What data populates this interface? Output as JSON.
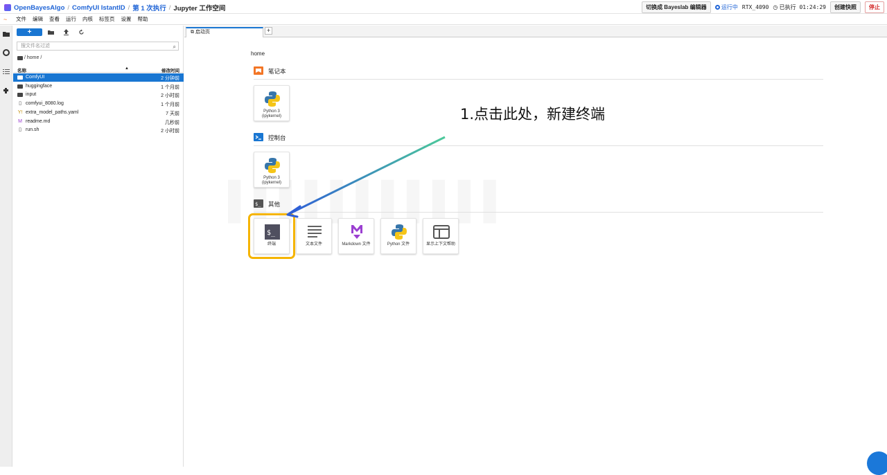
{
  "topbar": {
    "breadcrumbs": [
      "OpenBayesAlgo",
      "ComfyUI IstantID",
      "第 1 次执行"
    ],
    "current": "Jupyter 工作空间",
    "switch_editor": "切换成 Bayeslab 编辑器",
    "status": "运行中",
    "gpu": "RTX_4090",
    "elapsed": "已执行 01:24:29",
    "snapshot": "创建快照",
    "stop": "停止"
  },
  "menubar": [
    "文件",
    "编辑",
    "查看",
    "运行",
    "内核",
    "标签页",
    "设置",
    "帮助"
  ],
  "filebrowser": {
    "new_label": "+",
    "search_placeholder": "搜文件名过滤",
    "path": "/ home /",
    "col_name": "名称",
    "col_modified": "修改时间",
    "files": [
      {
        "name": "ComfyUI",
        "time": "2 分钟前",
        "type": "folder",
        "selected": true
      },
      {
        "name": "huggingface",
        "time": "1 个月前",
        "type": "folder"
      },
      {
        "name": "input",
        "time": "2 小时前",
        "type": "folder"
      },
      {
        "name": "comfyui_8080.log",
        "time": "1 个月前",
        "type": "file"
      },
      {
        "name": "extra_model_paths.yaml",
        "time": "7 天前",
        "type": "yaml"
      },
      {
        "name": "readme.md",
        "time": "几秒前",
        "type": "markdown"
      },
      {
        "name": "run.sh",
        "time": "2 小时前",
        "type": "file"
      }
    ]
  },
  "tab": {
    "label": "启动页",
    "add": "+"
  },
  "launcher": {
    "home": "home",
    "notebook_title": "笔记本",
    "console_title": "控制台",
    "other_title": "其他",
    "python_kernel_name": "Python 3",
    "python_kernel_sub": "(ipykernel)",
    "other_items": [
      "终端",
      "文本文件",
      "Markdown 文件",
      "Python 文件",
      "显示上下文帮助"
    ]
  },
  "annotation": "1.点击此处，新建终端"
}
